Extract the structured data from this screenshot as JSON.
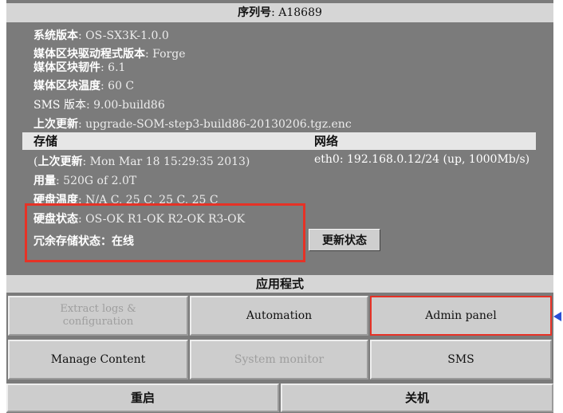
{
  "title": {
    "label": "序列号",
    "value": ": A18689"
  },
  "system": {
    "version_label": "系统版本",
    "version_value": ": OS-SX3K-1.0.0",
    "media_driver_label": "媒体区块驱动程式版本",
    "media_driver_value": ": Forge",
    "media_firmware_label": "媒体区块韧件",
    "media_firmware_value": ": 6.1",
    "media_temp_label": "媒体区块温度",
    "media_temp_value": ": 60 C",
    "sms_label": "SMS 版本",
    "sms_value": ": 9.00-build86",
    "last_update_label": "上次更新",
    "last_update_value": ": upgrade-SOM-step3-build86-20130206.tgz.enc"
  },
  "storage": {
    "header": "存储",
    "last_update_prefix": "(",
    "last_update_label": "上次更新",
    "last_update_value": ": Mon Mar 18 15:29:35 2013)",
    "capacity_label": "用量",
    "capacity_value": ": 520G of 2.0T",
    "disk_temp_label": "硬盘温度",
    "disk_temp_value": ": N/A C, 25 C, 25 C, 25 C",
    "disk_status_label": "硬盘状态",
    "disk_status_value": ": OS-OK R1-OK R2-OK R3-OK",
    "raid_status_label": "冗余存储状态：",
    "raid_status_value": "在线",
    "update_button": "更新状态"
  },
  "network": {
    "header": "网络",
    "eth0": "eth0: 192.168.0.12/24 (up, 1000Mb/s)"
  },
  "apps": {
    "header": "应用程式",
    "buttons": [
      {
        "label": "Extract logs &\nconfiguration",
        "state": "disabled"
      },
      {
        "label": "Automation",
        "state": "enabled"
      },
      {
        "label": "Admin panel",
        "state": "selected"
      },
      {
        "label": "Manage Content",
        "state": "enabled"
      },
      {
        "label": "System monitor",
        "state": "disabled"
      },
      {
        "label": "SMS",
        "state": "enabled"
      }
    ]
  },
  "power": {
    "restart": "重启",
    "shutdown": "关机"
  },
  "colors": {
    "panel": "#7b7b7b",
    "highlight": "#e63226",
    "pointer": "#2a4fd6"
  }
}
